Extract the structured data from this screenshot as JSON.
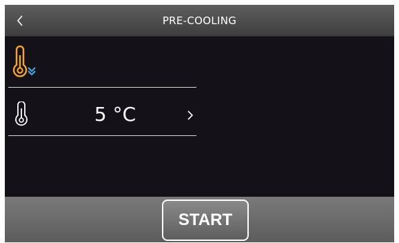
{
  "header": {
    "title": "PRE-COOLING",
    "back_icon": "chevron-left-icon"
  },
  "mode": {
    "icon": "thermometer-cooling-icon",
    "accent_thermometer": "#f5a623",
    "accent_arrows": "#35b6e8"
  },
  "temperature": {
    "value": "5 °C",
    "icon": "thermometer-icon",
    "arrow_icon": "chevron-right-icon"
  },
  "footer": {
    "start_label": "START"
  },
  "colors": {
    "background": "#141119",
    "header": "#4e4e4e",
    "footer": "#6a6a6a",
    "text": "#ffffff"
  }
}
